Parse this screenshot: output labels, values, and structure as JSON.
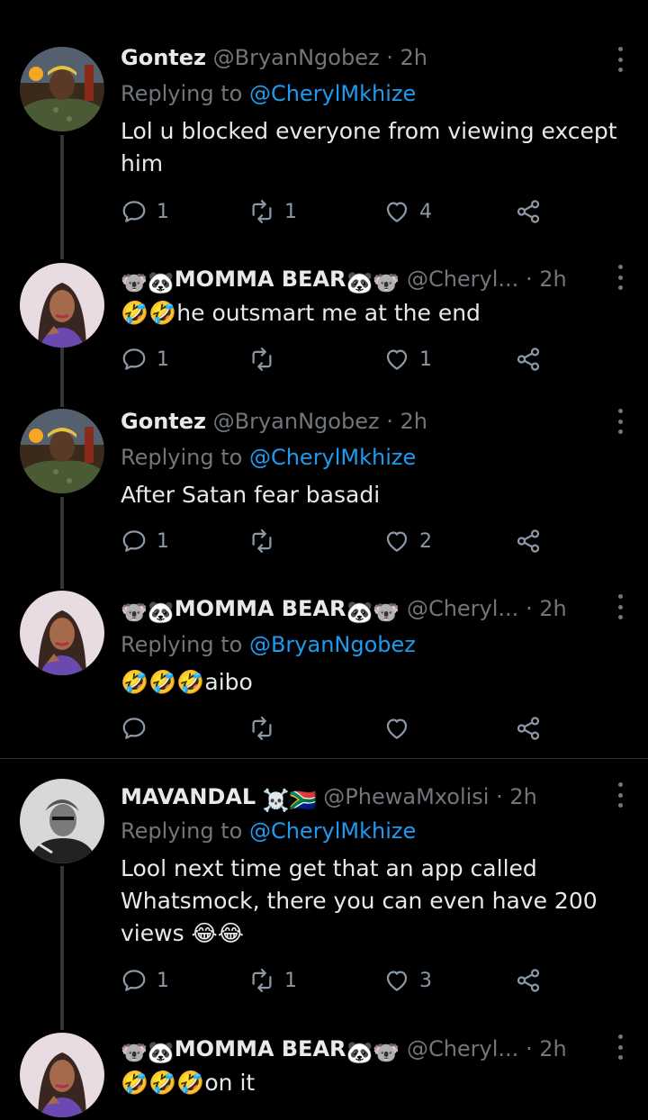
{
  "tweets": [
    {
      "name": "Gontez",
      "handle": "@BryanNgobez",
      "time": "2h",
      "replying_label": "Replying to",
      "replying_to": "@CherylMkhize",
      "body": "Lol u blocked everyone from viewing except him",
      "replies": "1",
      "retweets": "1",
      "likes": "4",
      "avatar": "man-cap-icon"
    },
    {
      "name": "MOMMA BEAR",
      "handle": "@Cheryl...",
      "time": "2h",
      "body_emojis": "🤣🤣",
      "body": "he outsmart me at the end",
      "replies": "1",
      "retweets": "",
      "likes": "1",
      "avatar": "woman-icon"
    },
    {
      "name": "Gontez",
      "handle": "@BryanNgobez",
      "time": "2h",
      "replying_label": "Replying to",
      "replying_to": "@CherylMkhize",
      "body": "After Satan fear basadi",
      "replies": "1",
      "retweets": "",
      "likes": "2",
      "avatar": "man-cap-icon"
    },
    {
      "name": "MOMMA BEAR",
      "handle": "@Cheryl...",
      "time": "2h",
      "replying_label": "Replying to",
      "replying_to": "@BryanNgobez",
      "body_emojis": "🤣🤣🤣",
      "body": "aibo",
      "replies": "",
      "retweets": "",
      "likes": "",
      "avatar": "woman-icon"
    },
    {
      "name": "MAVANDAL",
      "handle": "@PhewaMxolisi",
      "time": "2h",
      "replying_label": "Replying to",
      "replying_to": "@CherylMkhize",
      "body": "Lool next time get that an app called Whatsmock, there you can even have 200 views",
      "body_suffix_emojis": "😂😂",
      "replies": "1",
      "retweets": "1",
      "likes": "3",
      "avatar": "man-grayscale-icon"
    },
    {
      "name": "MOMMA BEAR",
      "handle": "@Cheryl...",
      "time": "2h",
      "body_emojis": "🤣🤣🤣",
      "body": "on it",
      "avatar": "woman-icon"
    }
  ],
  "colors": {
    "background": "#000000",
    "text": "#e7e9ea",
    "muted": "#71767b",
    "link": "#1d9bf0"
  }
}
